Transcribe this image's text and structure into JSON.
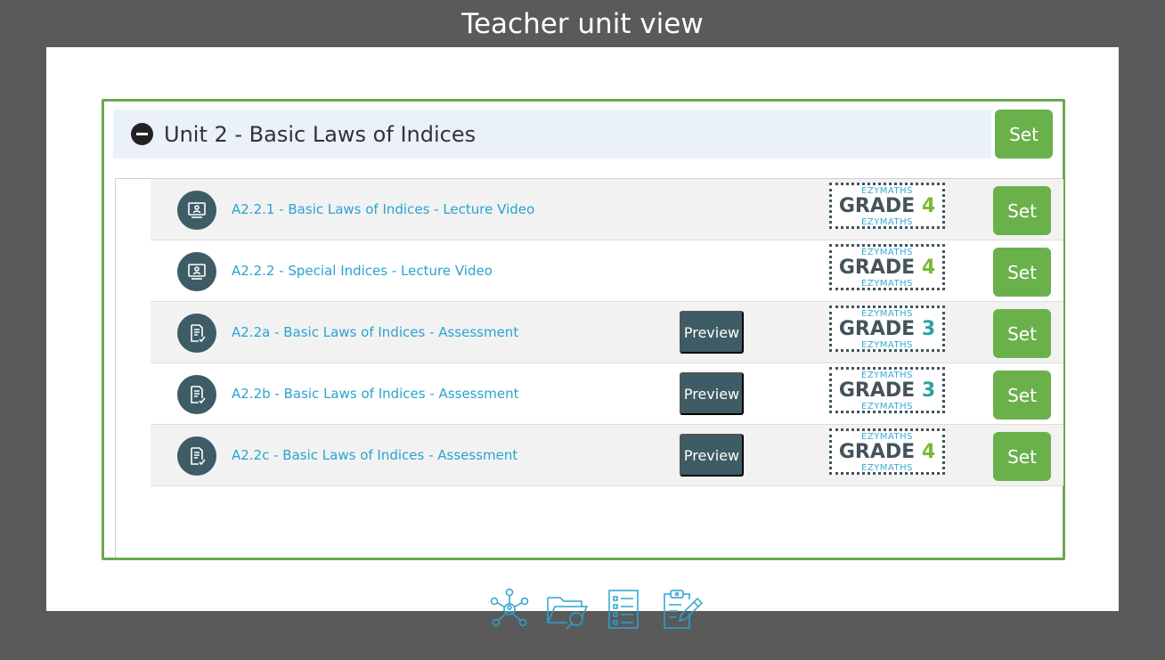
{
  "frame": {
    "title": "Teacher unit view"
  },
  "unit": {
    "title": "Unit 2 - Basic Laws of Indices",
    "set_label": "Set"
  },
  "brand": "EZYMATHS",
  "items": [
    {
      "type": "video",
      "icon": "lecture-video-icon",
      "label": "A2.2.1 - Basic Laws of Indices - Lecture Video",
      "preview": "",
      "grade_word": "GRADE",
      "grade": "4",
      "grade_color": "#7cb832",
      "set": "Set"
    },
    {
      "type": "video",
      "icon": "lecture-video-icon",
      "label": "A2.2.2 - Special Indices - Lecture Video",
      "preview": "",
      "grade_word": "GRADE",
      "grade": "4",
      "grade_color": "#7cb832",
      "set": "Set"
    },
    {
      "type": "assessment",
      "icon": "assessment-icon",
      "label": "A2.2a - Basic Laws of Indices - Assessment",
      "preview": "Preview",
      "grade_word": "GRADE",
      "grade": "3",
      "grade_color": "#2aa3a0",
      "set": "Set"
    },
    {
      "type": "assessment",
      "icon": "assessment-icon",
      "label": "A2.2b - Basic Laws of Indices - Assessment",
      "preview": "Preview",
      "grade_word": "GRADE",
      "grade": "3",
      "grade_color": "#2aa3a0",
      "set": "Set"
    },
    {
      "type": "assessment",
      "icon": "assessment-icon",
      "label": "A2.2c - Basic Laws of Indices - Assessment",
      "preview": "Preview",
      "grade_word": "GRADE",
      "grade": "4",
      "grade_color": "#7cb832",
      "set": "Set"
    }
  ],
  "footer_icons": [
    "network-icon",
    "folder-search-icon",
    "checklist-icon",
    "clipboard-edit-icon"
  ],
  "colors": {
    "accent_green": "#6ab14c",
    "border_green": "#6aa84f",
    "dark_teal": "#3d5c66",
    "link_blue": "#2aa3d0"
  }
}
